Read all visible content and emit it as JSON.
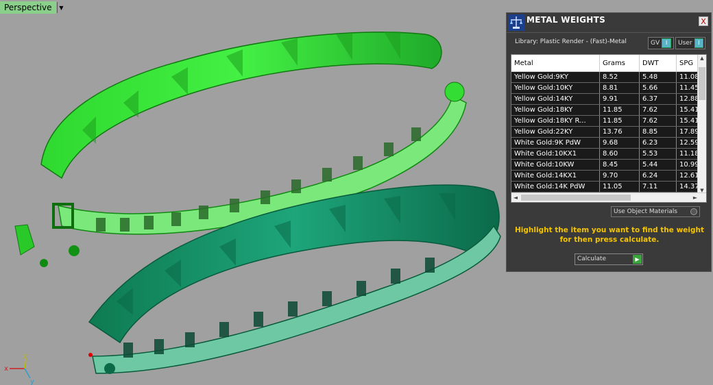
{
  "viewport": {
    "label": "Perspective",
    "dropdown_icon": "triangle-down-icon",
    "axis": {
      "x": "x",
      "y": "y",
      "z": "z"
    }
  },
  "panel": {
    "title": "METAL WEIGHTS",
    "logo_icon": "scale-logo-icon",
    "close_label": "X",
    "library": "Library: Plastic Render - (Fast)-Metal",
    "toggle_gv": "GV",
    "toggle_user": "User",
    "toggle_knob": "I",
    "table": {
      "headers": [
        "Metal",
        "Grams",
        "DWT",
        "SPG"
      ],
      "rows": [
        [
          "Yellow Gold:9KY",
          "8.52",
          "5.48",
          "11.08"
        ],
        [
          "Yellow Gold:10KY",
          "8.81",
          "5.66",
          "11.45"
        ],
        [
          "Yellow Gold:14KY",
          "9.91",
          "6.37",
          "12.88"
        ],
        [
          "Yellow Gold:18KY",
          "11.85",
          "7.62",
          "15.41"
        ],
        [
          "Yellow Gold:18KY R...",
          "11.85",
          "7.62",
          "15.41"
        ],
        [
          "Yellow Gold:22KY",
          "13.76",
          "8.85",
          "17.89"
        ],
        [
          "White Gold:9K PdW",
          "9.68",
          "6.23",
          "12.59"
        ],
        [
          "White Gold:10KX1",
          "8.60",
          "5.53",
          "11.18"
        ],
        [
          "White Gold:10KW",
          "8.45",
          "5.44",
          "10.99"
        ],
        [
          "White Gold:14KX1",
          "9.70",
          "6.24",
          "12.61"
        ],
        [
          "White Gold:14K PdW",
          "11.05",
          "7.11",
          "14.37"
        ]
      ]
    },
    "use_object_materials": "Use Object Materials",
    "hint": "Highlight the item you want to find the weight for then press calculate.",
    "calculate": "Calculate"
  },
  "colors": {
    "background": "#a0a0a0",
    "top_coil": "#33ee33",
    "bottom_coil": "#14956a",
    "hint_text": "#f4c400",
    "panel_bg": "#3a3a3a"
  }
}
